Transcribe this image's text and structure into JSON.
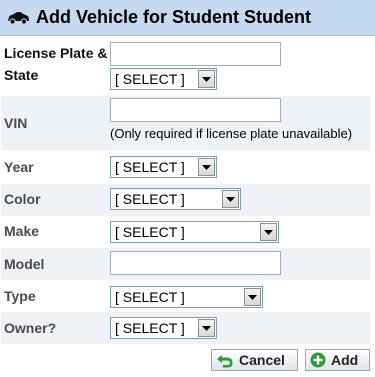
{
  "title": "Add Vehicle for Student Student",
  "form": {
    "license_label": "License Plate & State",
    "license_plate_value": "",
    "license_state_select": "[ SELECT ]",
    "vin_label": "VIN",
    "vin_value": "",
    "vin_hint": "(Only required if license plate unavailable)",
    "year_label": "Year",
    "year_select": "[ SELECT ]",
    "color_label": "Color",
    "color_select": "[ SELECT ]",
    "make_label": "Make",
    "make_select": "[ SELECT ]",
    "model_label": "Model",
    "model_value": "",
    "type_label": "Type",
    "type_select": "[ SELECT ]",
    "owner_label": "Owner?",
    "owner_select": "[ SELECT ]"
  },
  "buttons": {
    "cancel": "Cancel",
    "add": "Add"
  },
  "icons": {
    "title": "car-icon",
    "cancel": "undo-arrow-icon",
    "add": "plus-circle-icon"
  },
  "colors": {
    "header_bg": "#c5d9f1",
    "row_shade": "#eef2f7",
    "cancel_icon": "#2f9a3b",
    "add_icon": "#2f9a3b"
  }
}
